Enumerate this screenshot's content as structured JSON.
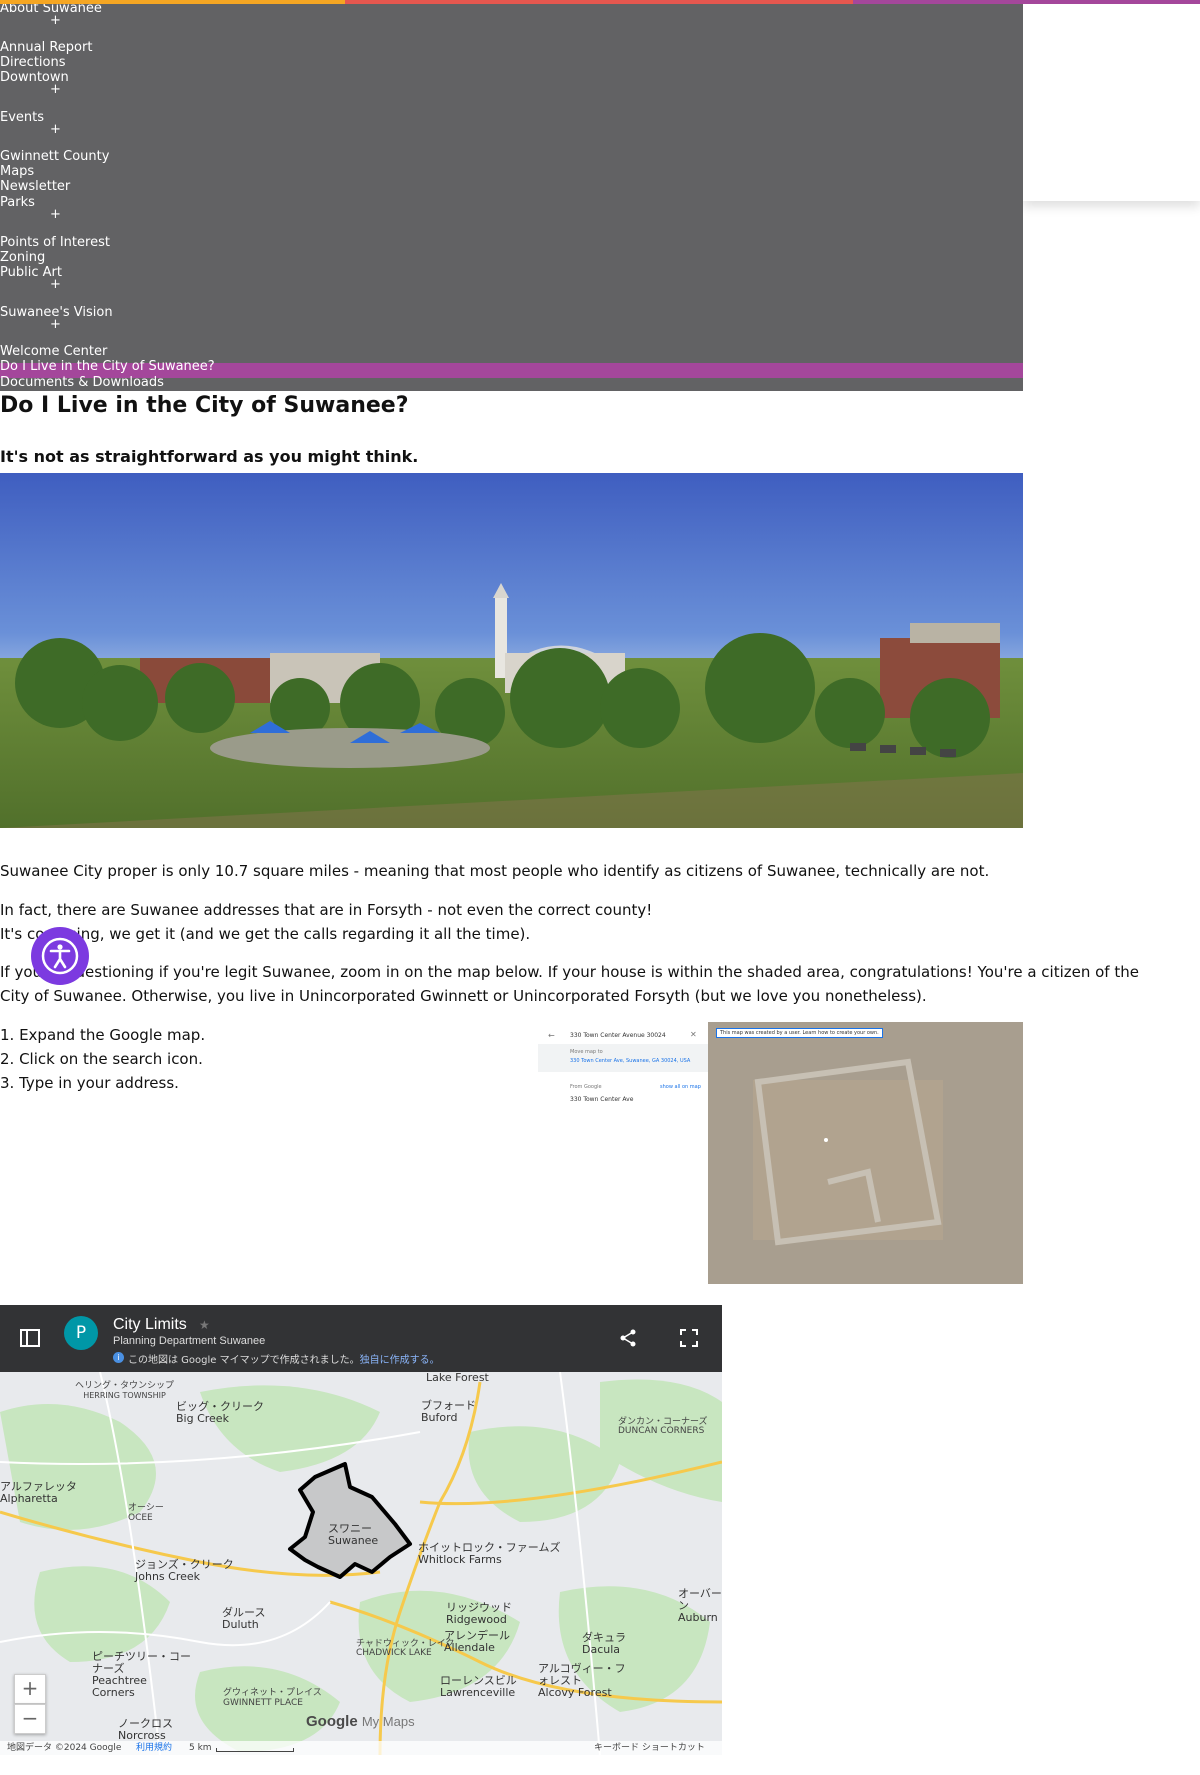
{
  "colors": {
    "accent_orange": "#f5a623",
    "accent_red": "#e6574f",
    "accent_purple": "#a4479b",
    "nav_bg": "#626264",
    "a11y": "#7c3ae0"
  },
  "nav": {
    "items": [
      {
        "label": "About Suwanee",
        "expandable": true
      },
      {
        "label": "Annual Report",
        "expandable": false
      },
      {
        "label": "Directions",
        "expandable": false
      },
      {
        "label": "Downtown",
        "expandable": true
      },
      {
        "label": "Events",
        "expandable": true
      },
      {
        "label": "Gwinnett County",
        "expandable": false
      },
      {
        "label": "Maps",
        "expandable": false
      },
      {
        "label": "Newsletter",
        "expandable": false
      },
      {
        "label": "Parks",
        "expandable": true
      },
      {
        "label": "Points of Interest",
        "expandable": false
      },
      {
        "label": "Zoning",
        "expandable": false
      },
      {
        "label": "Public Art",
        "expandable": true
      },
      {
        "label": "Suwanee's Vision",
        "expandable": true
      },
      {
        "label": "Welcome Center",
        "expandable": false
      },
      {
        "label": "Do I Live in the City of Suwanee?",
        "expandable": false,
        "active": true
      },
      {
        "label": "Documents & Downloads",
        "expandable": false
      }
    ],
    "plus_symbol": "+"
  },
  "page": {
    "title": "Do I Live in the City of Suwanee?",
    "subtitle": "It's not as straightforward as you might think.",
    "p1": "Suwanee City proper is only 10.7 square miles - meaning that most people who identify as citizens of Suwanee, technically are not.",
    "p2": "In fact, there are Suwanee addresses that are in Forsyth - not even the correct county!",
    "p3": "It's confusing, we get it (and we get the calls regarding it all the time).",
    "p4_line1": "If you're questioning if you're legit Suwanee, zoom in on the map below. If your house is within the shaded area, congratulations! You're a citizen of the",
    "p4_line2": "City of Suwanee. Otherwise, you live in Unincorporated Gwinnett or Unincorporated Forsyth  (but we love you nonetheless).",
    "steps": [
      "1. Expand the Google map.",
      "2. Click on the search icon.",
      "3. Type in your address."
    ]
  },
  "thumb": {
    "search_text": "330 Town Center Avenue 30024",
    "move_map": "Move map to",
    "address_link": "330 Town Center Ave, Suwanee, GA 30024, USA",
    "from_google": "From Google",
    "show_all": "show all on map",
    "result": "330 Town Center Ave",
    "banner": "This map was created by a user. Learn how to create your own."
  },
  "map": {
    "title": "City Limits",
    "star": "★",
    "subtitle": "Planning Department Suwanee",
    "avatar_letter": "P",
    "notice": "この地図は Google マイマップで作成されました。",
    "notice_link": "独自に作成する。",
    "footer_data": "地図データ ©2024 Google",
    "footer_terms": "利用規約",
    "footer_scale": "5 km",
    "footer_shortcuts": "キーボード ショートカット",
    "logo_google": "Google",
    "logo_mymaps": "My Maps",
    "zoom_in": "+",
    "zoom_out": "−",
    "places": [
      {
        "jp": "ヘリング・タウンシップ",
        "en": "HERRING TOWNSHIP"
      },
      {
        "jp": "ビッグ・クリーク",
        "en": "Big Creek"
      },
      {
        "jp": "",
        "en": "Lake Forest"
      },
      {
        "jp": "ブフォード",
        "en": "Buford"
      },
      {
        "jp": "ダンカン・コーナーズ",
        "en": "DUNCAN CORNERS"
      },
      {
        "jp": "アルファレッタ",
        "en": "Alpharetta"
      },
      {
        "jp": "オーシー",
        "en": "OCEE"
      },
      {
        "jp": "スワニー",
        "en": "Suwanee"
      },
      {
        "jp": "ホイットロック・ファームズ",
        "en": "Whitlock Farms"
      },
      {
        "jp": "ジョンズ・クリーク",
        "en": "Johns Creek"
      },
      {
        "jp": "ダルース",
        "en": "Duluth"
      },
      {
        "jp": "リッジウッド",
        "en": "Ridgewood"
      },
      {
        "jp": "オーバーン",
        "en": "Auburn"
      },
      {
        "jp": "チャドウィック・レイク",
        "en": "CHADWICK LAKE"
      },
      {
        "jp": "アレンデール",
        "en": "Allendale"
      },
      {
        "jp": "ダキュラ",
        "en": "Dacula"
      },
      {
        "jp": "ピーチツリー・コーナーズ",
        "en": "Peachtree Corners"
      },
      {
        "jp": "グウィネット・プレイス",
        "en": "GWINNETT PLACE"
      },
      {
        "jp": "ローレンスビル",
        "en": "Lawrenceville"
      },
      {
        "jp": "アルコヴィー・フォレスト",
        "en": "Alcovy Forest"
      },
      {
        "jp": "ノークロス",
        "en": "Norcross"
      }
    ]
  }
}
